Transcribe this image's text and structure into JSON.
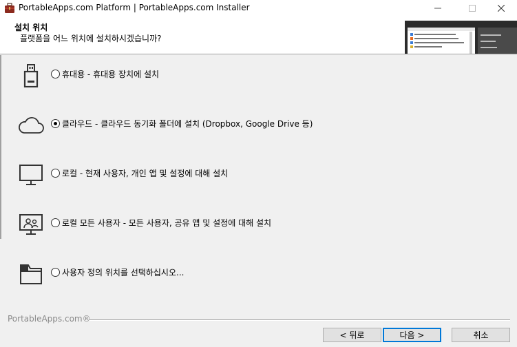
{
  "window": {
    "title": "PortableApps.com Platform | PortableApps.com Installer",
    "app_icon": "briefcase-icon"
  },
  "header": {
    "title": "설치 위치",
    "subtitle": "플랫폼을 어느 위치에 설치하시겠습니까?",
    "image_icon": "portableapps-menu-preview"
  },
  "options": [
    {
      "icon": "usb-drive-icon",
      "label": "휴대용 - 휴대용 장치에 설치",
      "selected": false
    },
    {
      "icon": "cloud-icon",
      "label": "클라우드 - 클라우드 동기화 폴더에 설치 (Dropbox, Google Drive 등)",
      "selected": true
    },
    {
      "icon": "monitor-icon",
      "label": "로컬 - 현재 사용자, 개인 앱 및 설정에 대해 설치",
      "selected": false
    },
    {
      "icon": "monitor-users-icon",
      "label": "로컬 모든 사용자 - 모든 사용자, 공유 앱 및 설정에 대해 설치",
      "selected": false
    },
    {
      "icon": "folder-icon",
      "label": "사용자 정의 위치를 선택하십시오...",
      "selected": false
    }
  ],
  "footer": {
    "branding": "PortableApps.com®",
    "back_label": "< 뒤로",
    "next_label": "다음 >",
    "cancel_label": "취소"
  },
  "colors": {
    "accent": "#0078d7",
    "background": "#f0f0f0"
  }
}
